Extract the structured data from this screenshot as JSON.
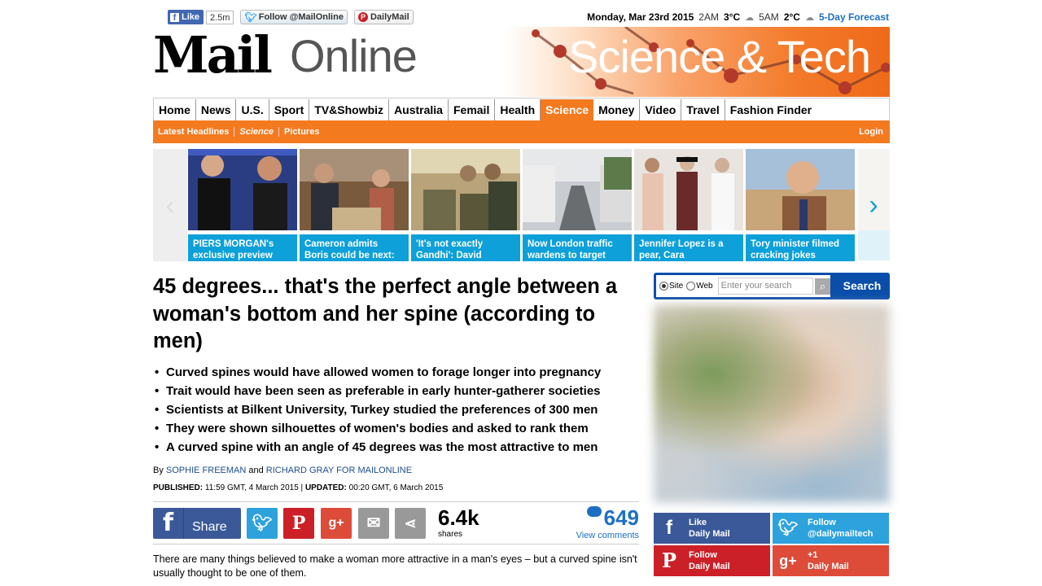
{
  "topbar": {
    "fb_like": "Like",
    "fb_count": "2.5m",
    "twitter_follow": "Follow @MailOnline",
    "pinterest": "DailyMail",
    "date": "Monday, Mar 23rd 2015",
    "time1": "2AM",
    "temp1": "3°C",
    "time2": "5AM",
    "temp2": "2°C",
    "forecast": "5-Day Forecast"
  },
  "masthead": {
    "logo_mail": "Mail",
    "logo_online": "Online",
    "section_title": "Science & Tech"
  },
  "nav": {
    "items": [
      "Home",
      "News",
      "U.S.",
      "Sport",
      "TV&Showbiz",
      "Australia",
      "Femail",
      "Health",
      "Science",
      "Money",
      "Video",
      "Travel",
      "Fashion Finder"
    ],
    "active": "Science"
  },
  "subnav": {
    "items": [
      "Latest Headlines",
      "Science",
      "Pictures"
    ],
    "login": "Login"
  },
  "carousel": [
    {
      "caption": "PIERS MORGAN's exclusive preview"
    },
    {
      "caption": "Cameron admits Boris could be next:"
    },
    {
      "caption": "'It's not exactly Gandhi': David"
    },
    {
      "caption": "Now London traffic wardens to target"
    },
    {
      "caption": "Jennifer Lopez is a pear, Cara"
    },
    {
      "caption": "Tory minister filmed cracking jokes"
    }
  ],
  "article": {
    "headline": "45 degrees... that's the perfect angle between a woman's bottom and her spine (according to men)",
    "bullets": [
      "Curved spines would have allowed women to forage longer into pregnancy",
      "Trait would have been seen as preferable in early hunter-gatherer societies",
      "Scientists at Bilkent University, Turkey studied the preferences of 300 men",
      "They were shown  silhouettes of women's bodies and asked to rank them",
      "A curved spine with an angle of 45 degrees was the most attractive to men"
    ],
    "by": "By",
    "author1": "SOPHIE FREEMAN",
    "and": "and",
    "author2": "RICHARD GRAY FOR MAILONLINE",
    "published_label": "PUBLISHED:",
    "published": "11:59 GMT, 4 March 2015",
    "updated_label": "UPDATED:",
    "updated": "00:20 GMT, 6 March 2015",
    "intro": "There are many things believed to make a woman more attractive in a man's eyes – but a curved spine isn't usually thought to be one of them."
  },
  "share": {
    "facebook_label": "Share",
    "count": "6.4k",
    "count_label": "shares",
    "comments": "649",
    "view_comments": "View comments"
  },
  "search": {
    "site": "Site",
    "web": "Web",
    "placeholder": "Enter your search",
    "button": "Search"
  },
  "social": {
    "fb_line1": "Like",
    "fb_line2": "Daily Mail",
    "tw_line1": "Follow",
    "tw_line2": "@dailymailtech",
    "pin_line1": "Follow",
    "pin_line2": "Daily Mail",
    "gp_line1": "+1",
    "gp_line2": "Daily Mail"
  }
}
